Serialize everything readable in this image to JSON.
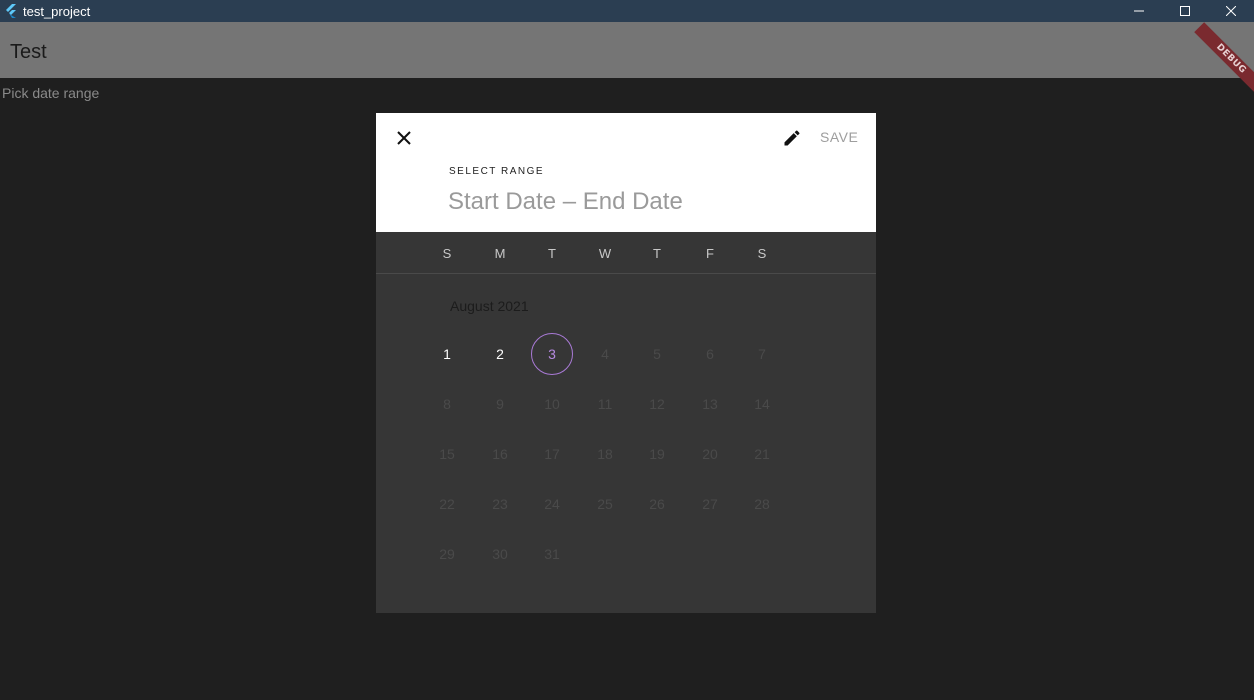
{
  "window": {
    "title": "test_project",
    "controls": {
      "minimize": "—",
      "maximize": "☐",
      "close": "✕"
    }
  },
  "appbar": {
    "title": "Test",
    "debug_banner": "DEBUG"
  },
  "body": {
    "text": "Pick date range"
  },
  "dialog": {
    "save_label": "SAVE",
    "select_range_label": "SELECT RANGE",
    "range_text": "Start Date – End Date",
    "weekdays": [
      "S",
      "M",
      "T",
      "W",
      "T",
      "F",
      "S"
    ],
    "month_label": "August 2021",
    "today": "3",
    "days": [
      [
        "1",
        "2",
        "3",
        "4",
        "5",
        "6",
        "7"
      ],
      [
        "8",
        "9",
        "10",
        "11",
        "12",
        "13",
        "14"
      ],
      [
        "15",
        "16",
        "17",
        "18",
        "19",
        "20",
        "21"
      ],
      [
        "22",
        "23",
        "24",
        "25",
        "26",
        "27",
        "28"
      ],
      [
        "29",
        "30",
        "31",
        "",
        "",
        "",
        ""
      ]
    ],
    "enabled_days": [
      "1",
      "2",
      "3"
    ]
  },
  "colors": {
    "titlebar": "#2b3e52",
    "appbar_dimmed": "#757575",
    "background": "#1f1f1f",
    "dialog_header": "#ffffff",
    "dialog_body": "#363636",
    "today_ring": "#a97ad6"
  }
}
